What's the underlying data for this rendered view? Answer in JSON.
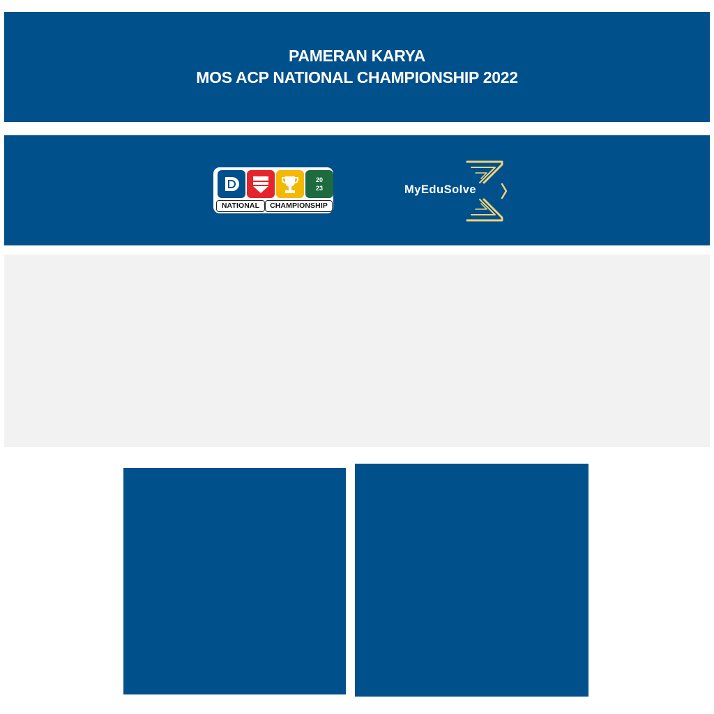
{
  "header": {
    "title_line1": "PAMERAN KARYA",
    "title_line2": "MOS ACP NATIONAL CHAMPIONSHIP 2022"
  },
  "logos": {
    "national_championship": {
      "year_top": "20",
      "year_bottom": "23",
      "caption_left": "NATIONAL",
      "caption_right": "CHAMPIONSHIP",
      "tile_colors": [
        "#00508B",
        "#E4252B",
        "#F5B800",
        "#1D6B3E"
      ]
    },
    "myedusolve": {
      "name": "MyEduSolve",
      "accent_color": "#F2D27A"
    }
  },
  "colors": {
    "brand_blue": "#00508B",
    "panel_gray": "#F2F2F2",
    "background": "#FFFFFF"
  }
}
